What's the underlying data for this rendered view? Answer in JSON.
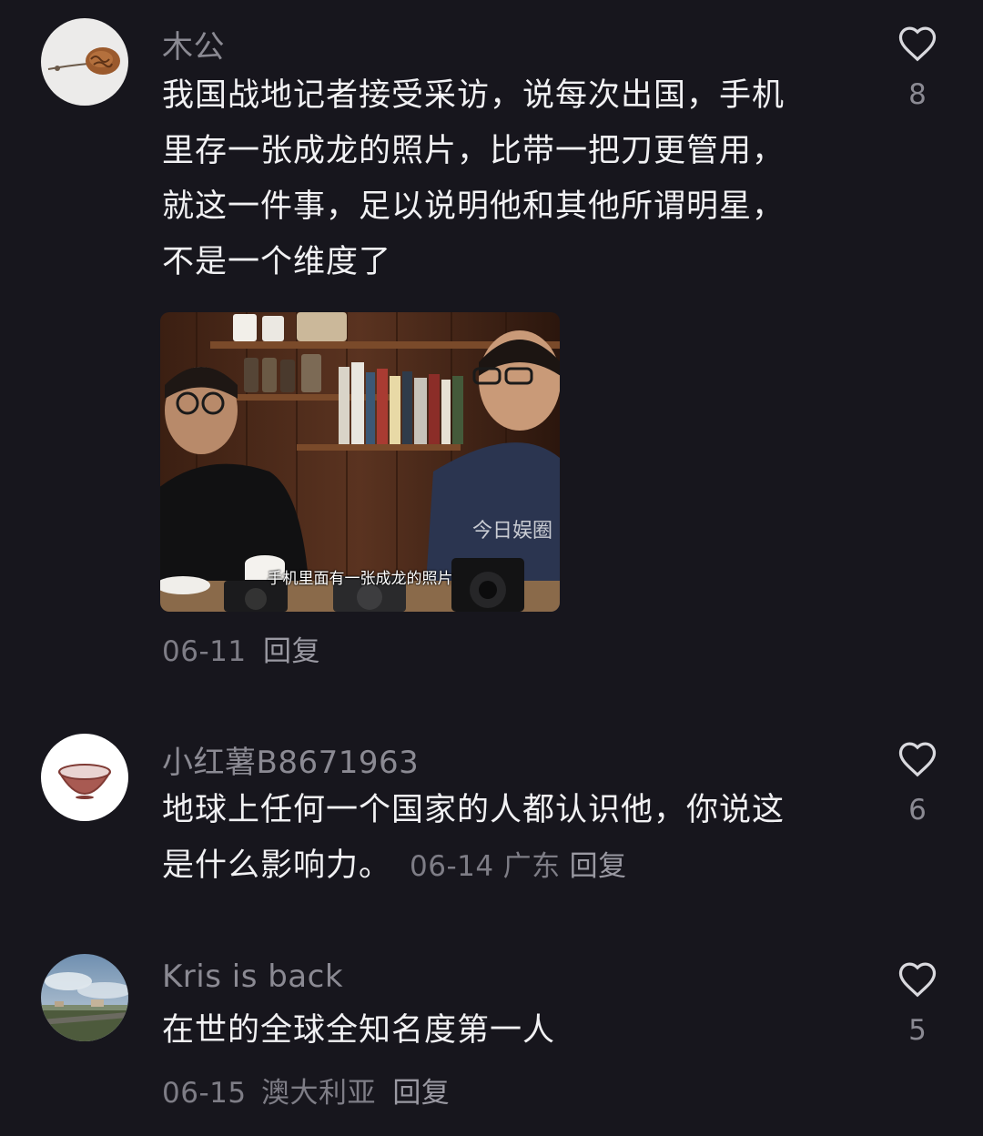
{
  "comments": [
    {
      "username": "木公",
      "avatar_icon": "walnut-spoon-avatar",
      "lines": [
        "我国战地记者接受采访，说每次出国，手机",
        "里存一张成龙的照片，比带一把刀更管用，",
        "就这一件事，足以说明他和其他所谓明星，",
        "不是一个维度了"
      ],
      "image": {
        "watermark": "今日娱圈",
        "subtitle": "手机里面有一张成龙的照片"
      },
      "date": "06-11",
      "reply": "回复",
      "likes": "8"
    },
    {
      "username": "小红薯B8671963",
      "avatar_icon": "bowl-avatar",
      "lines": [
        "地球上任何一个国家的人都认识他，你说这",
        "是什么影响力。"
      ],
      "date": "06-14",
      "location": "广东",
      "reply": "回复",
      "likes": "6"
    },
    {
      "username": "Kris is back",
      "avatar_icon": "landscape-avatar",
      "lines": [
        "在世的全球全知名度第一人"
      ],
      "date": "06-15",
      "location": "澳大利亚",
      "reply": "回复",
      "likes": "5"
    }
  ],
  "colors": {
    "background": "#17161d",
    "username": "#8b8a93",
    "text": "#f1f1f3",
    "meta": "#7e7d86"
  }
}
